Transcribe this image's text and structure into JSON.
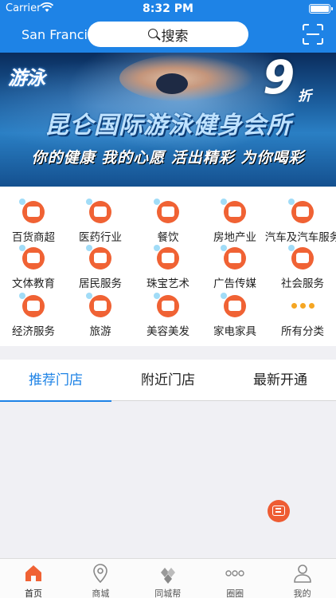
{
  "status": {
    "carrier": "Carrier",
    "time": "8:32 PM"
  },
  "header": {
    "city": "San Francisco",
    "search_label": "搜索"
  },
  "banner": {
    "logo": "游泳",
    "discount_number": "9",
    "discount_unit": "折",
    "title": "昆仑国际游泳健身会所",
    "slogan": "你的健康 我的心愿 活出精彩 为你喝彩",
    "dots": 9,
    "active_dot": 7
  },
  "categories": [
    {
      "label": "百货商超",
      "icon": "shopping-cart-icon",
      "color": "#f06234"
    },
    {
      "label": "医药行业",
      "icon": "medicine-kit-icon",
      "color": "#f06234"
    },
    {
      "label": "餐饮",
      "icon": "utensils-icon",
      "color": "#f06234"
    },
    {
      "label": "房地产业",
      "icon": "building-icon",
      "color": "#f06234"
    },
    {
      "label": "汽车及汽车服务",
      "icon": "car-icon",
      "color": "#f06234"
    },
    {
      "label": "文体教育",
      "icon": "books-icon",
      "color": "#f06234"
    },
    {
      "label": "居民服务",
      "icon": "home-service-icon",
      "color": "#f06234"
    },
    {
      "label": "珠宝艺术",
      "icon": "crown-icon",
      "color": "#f06234"
    },
    {
      "label": "广告传媒",
      "icon": "video-camera-icon",
      "color": "#f06234"
    },
    {
      "label": "社会服务",
      "icon": "community-icon",
      "color": "#f06234"
    },
    {
      "label": "经济服务",
      "icon": "finance-icon",
      "color": "#f06234"
    },
    {
      "label": "旅游",
      "icon": "airplane-icon",
      "color": "#f06234"
    },
    {
      "label": "美容美发",
      "icon": "beauty-icon",
      "color": "#f06234"
    },
    {
      "label": "家电家具",
      "icon": "tv-icon",
      "color": "#f06234"
    },
    {
      "label": "所有分类",
      "icon": "more-dots-icon",
      "color": "#f5a623"
    }
  ],
  "tabs": [
    {
      "label": "推荐门店",
      "active": true
    },
    {
      "label": "附近门店",
      "active": false
    },
    {
      "label": "最新开通",
      "active": false
    }
  ],
  "bottom_nav": [
    {
      "label": "首页",
      "icon": "home-icon",
      "active": true
    },
    {
      "label": "商城",
      "icon": "location-pin-icon",
      "active": false
    },
    {
      "label": "同城帮",
      "icon": "diamond-logo-icon",
      "active": false
    },
    {
      "label": "圈圈",
      "icon": "ellipsis-icon",
      "active": false
    },
    {
      "label": "我的",
      "icon": "user-icon",
      "active": false
    }
  ],
  "colors": {
    "primary": "#1e83e6",
    "accent": "#f06234",
    "fab": "#ee5c33"
  }
}
